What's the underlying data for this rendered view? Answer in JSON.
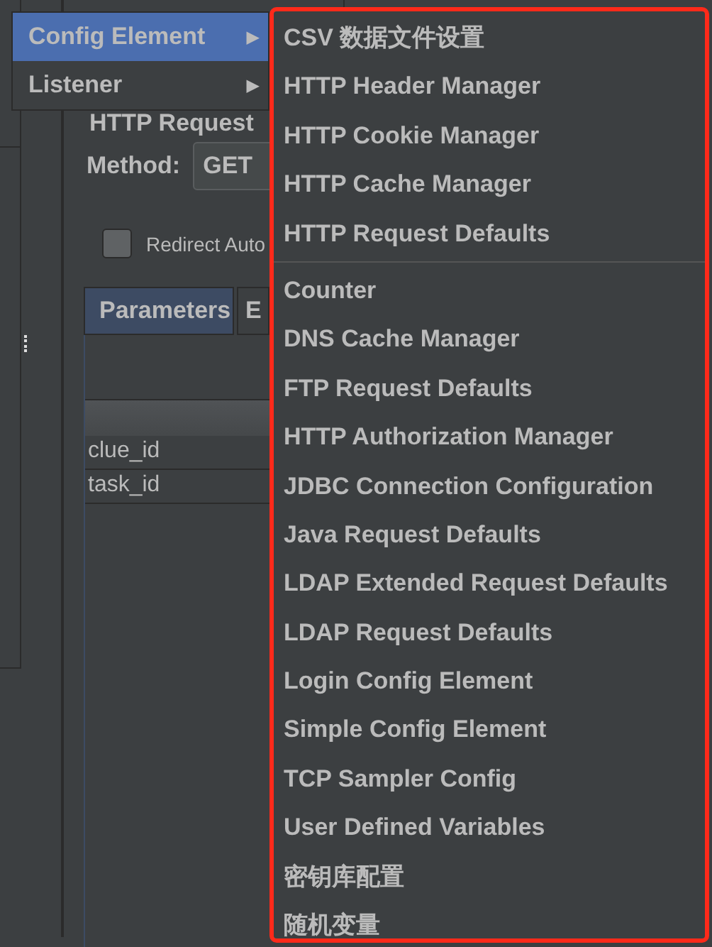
{
  "background_panel": {
    "title": "HTTP Request",
    "method_label": "Method:",
    "method_value": "GET",
    "redirect_checkbox": {
      "label": "Redirect Auto",
      "checked": false
    },
    "tabs": [
      {
        "label": "Parameters",
        "selected": true
      },
      {
        "label": "E",
        "selected": false
      }
    ],
    "parameter_rows": [
      "clue_id",
      "task_id"
    ]
  },
  "menu": {
    "items": [
      {
        "label": "Config Element",
        "selected": true,
        "arrow": "▶"
      },
      {
        "label": "Listener",
        "selected": false,
        "arrow": "▶"
      }
    ]
  },
  "submenu": {
    "sections": [
      [
        "CSV 数据文件设置",
        "HTTP Header Manager",
        "HTTP Cookie Manager",
        "HTTP Cache Manager",
        "HTTP Request Defaults"
      ],
      [
        "Counter",
        "DNS Cache Manager",
        "FTP Request Defaults",
        "HTTP Authorization Manager",
        "JDBC Connection Configuration",
        "Java Request Defaults",
        "LDAP Extended Request Defaults",
        "LDAP Request Defaults",
        "Login Config Element",
        "Simple Config Element",
        "TCP Sampler Config",
        "User Defined Variables",
        "密钥库配置",
        "随机变量"
      ]
    ]
  }
}
